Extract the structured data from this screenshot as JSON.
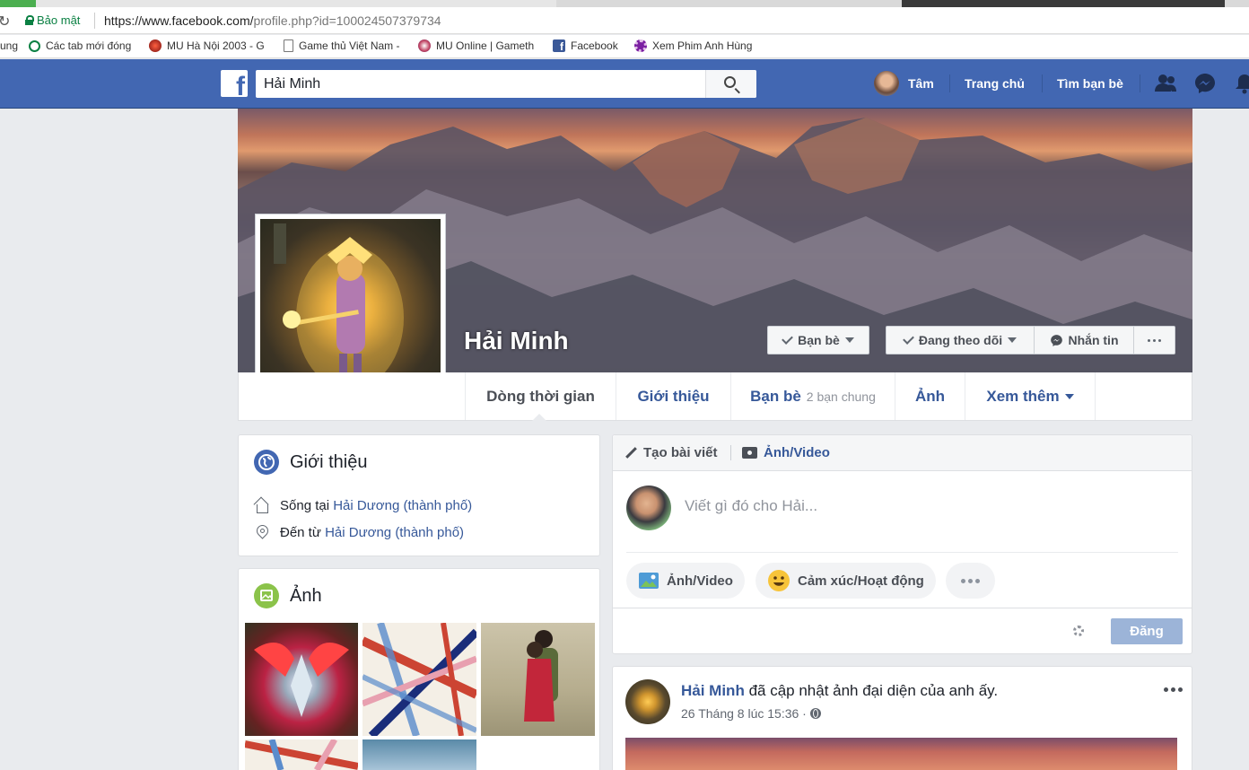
{
  "browser": {
    "secure_label": "Bảo mật",
    "url_main": "https://www.facebook.com/",
    "url_rest": "profile.php?id=100024507379734",
    "bookmarks": [
      {
        "label": "ung"
      },
      {
        "label": "Các tab mới đóng",
        "icon": "history-icon"
      },
      {
        "label": "MU Hà Nội 2003 - G",
        "icon": "mu-icon"
      },
      {
        "label": "Game thủ Việt Nam -",
        "icon": "page-icon"
      },
      {
        "label": "MU Online | Gameth",
        "icon": "mu-online-icon"
      },
      {
        "label": "Facebook",
        "icon": "facebook-icon"
      },
      {
        "label": "Xem Phim Anh Hùng",
        "icon": "film-icon"
      }
    ]
  },
  "fbbar": {
    "search_value": "Hải Minh",
    "user_name": "Tâm",
    "home": "Trang chủ",
    "find_friends": "Tìm bạn bè"
  },
  "profile": {
    "name": "Hải Minh",
    "friends_button": "Bạn bè",
    "following_button": "Đang theo dõi",
    "message_button": "Nhắn tin",
    "tabs": [
      {
        "label": "Dòng thời gian"
      },
      {
        "label": "Giới thiệu"
      },
      {
        "label": "Bạn bè",
        "sub": "2 bạn chung"
      },
      {
        "label": "Ảnh"
      },
      {
        "label": "Xem thêm"
      }
    ]
  },
  "intro": {
    "title": "Giới thiệu",
    "lives_prefix": "Sống tại",
    "lives_place": "Hải Dương (thành phố)",
    "from_prefix": "Đến từ",
    "from_place": "Hải Dương (thành phố)"
  },
  "photos": {
    "title": "Ảnh"
  },
  "composer": {
    "create_post": "Tạo bài viết",
    "photo_video_tab": "Ảnh/Video",
    "placeholder": "Viết gì đó cho Hải...",
    "photo_video": "Ảnh/Video",
    "feeling": "Cảm xúc/Hoạt động",
    "post_button": "Đăng"
  },
  "post": {
    "author": "Hải Minh",
    "action": " đã cập nhật ảnh đại diện của anh ấy.",
    "time": "26 Tháng 8 lúc 15:36 ·"
  },
  "colors": {
    "fb_blue": "#4267b2",
    "link": "#365899",
    "page_bg": "#e9ebee"
  }
}
